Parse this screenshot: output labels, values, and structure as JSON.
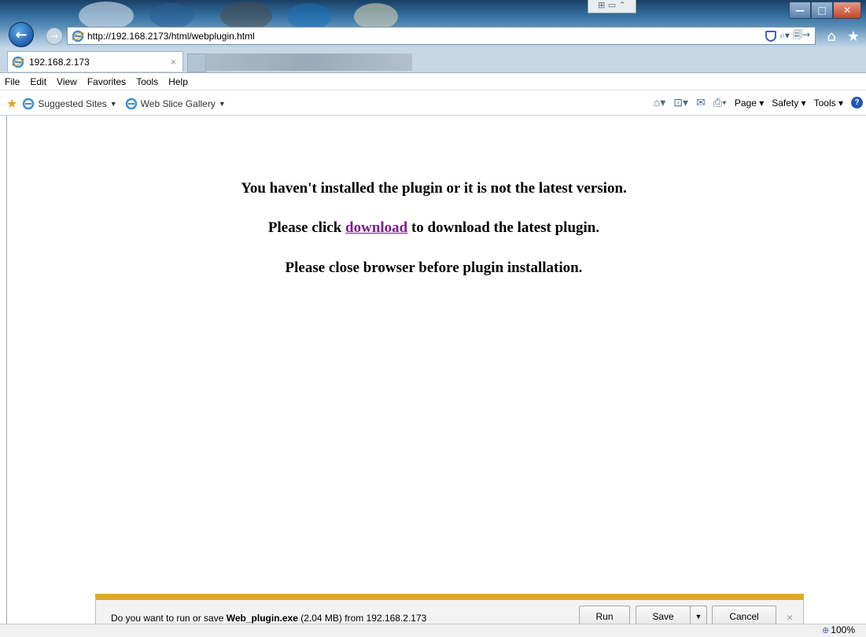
{
  "window": {
    "pin_glyph": "⊞ ▭ ⌃",
    "minimize_glyph": "—",
    "maximize_glyph": "□",
    "close_glyph": "✕"
  },
  "nav": {
    "back_glyph": "←",
    "forward_glyph": "→",
    "url": "http://192.168.2173/html/webplugin.html",
    "search_glyph": "⌕▾",
    "compat_glyph": "🗐→",
    "home_glyph": "⌂",
    "favorites_glyph": "★"
  },
  "tab": {
    "label": "192.168.2.173",
    "close_glyph": "×"
  },
  "menu": {
    "items": [
      "File",
      "Edit",
      "View",
      "Favorites",
      "Tools",
      "Help"
    ]
  },
  "favorites_bar": {
    "items": [
      {
        "label": "Suggested Sites",
        "caret": "▼"
      },
      {
        "label": "Web Slice Gallery",
        "caret": "▼"
      }
    ]
  },
  "command_bar": {
    "page_label": "Page ▾",
    "safety_label": "Safety ▾",
    "tools_label": "Tools ▾",
    "help_glyph": "?"
  },
  "page": {
    "line1": "You haven't installed the plugin or it is not the latest version.",
    "line2_prefix": "Please click ",
    "line2_link": "download",
    "line2_suffix": " to download the latest plugin.",
    "line3": "Please close browser before plugin installation."
  },
  "download_bar": {
    "prompt_prefix": "Do you want to run or save ",
    "filename": "Web_plugin.exe",
    "size": "(2.04 MB)",
    "prompt_suffix": " from 192.168.2.173",
    "run_label": "Run",
    "save_label": "Save",
    "save_dropdown_glyph": "▼",
    "cancel_label": "Cancel",
    "close_glyph": "×"
  },
  "status": {
    "zoom": "100%",
    "zoom_glyph": "⊕"
  },
  "colors": {
    "link_visited": "#7a1d8a",
    "notification_accent": "#e2a91a"
  }
}
